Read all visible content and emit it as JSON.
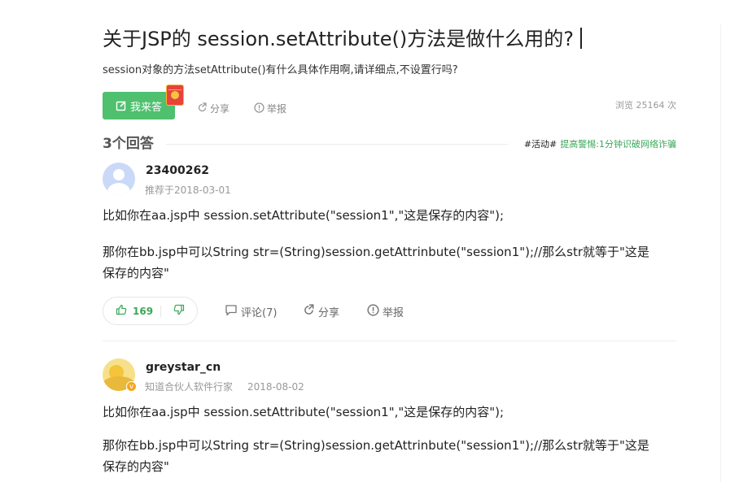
{
  "question": {
    "title": "关于JSP的 session.setAttribute()方法是做什么用的?",
    "description": "session对象的方法setAttribute()有什么具体作用啊,请详细点,不设置行吗?",
    "answer_button": "我来答",
    "share": "分享",
    "report": "举报",
    "views": "浏览 25164 次"
  },
  "answers_header": {
    "count_label": "3个回答",
    "promo_tag": "#活动#",
    "promo_text": "提高警惕:1分钟识破网络诈骗"
  },
  "answers": [
    {
      "username": "23400262",
      "meta": "推荐于2018-03-01",
      "paragraphs": [
        "比如你在aa.jsp中 session.setAttribute(\"session1\",\"这是保存的内容\");",
        "那你在bb.jsp中可以String str=(String)session.getAttrinbute(\"session1\");//那么str就等于\"这是",
        "保存的内容\""
      ],
      "likes": "169",
      "comments": "评论(7)",
      "share": "分享",
      "report": "举报"
    },
    {
      "username": "greystar_cn",
      "meta": "知道合伙人软件行家",
      "date": "2018-08-02",
      "badge": "v",
      "paragraphs": [
        "比如你在aa.jsp中 session.setAttribute(\"session1\",\"这是保存的内容\");",
        "那你在bb.jsp中可以String str=(String)session.getAttrinbute(\"session1\");//那么str就等于\"这是",
        "保存的内容\""
      ]
    }
  ],
  "colors": {
    "brand_green": "#4fc06e",
    "link_green": "#3aa757",
    "muted": "#999999"
  },
  "icons": [
    "edit-icon",
    "red-envelope-icon",
    "share-icon",
    "report-icon",
    "thumbs-up-icon",
    "thumbs-down-icon",
    "comment-icon",
    "user-avatar-icon",
    "expert-badge-icon"
  ]
}
